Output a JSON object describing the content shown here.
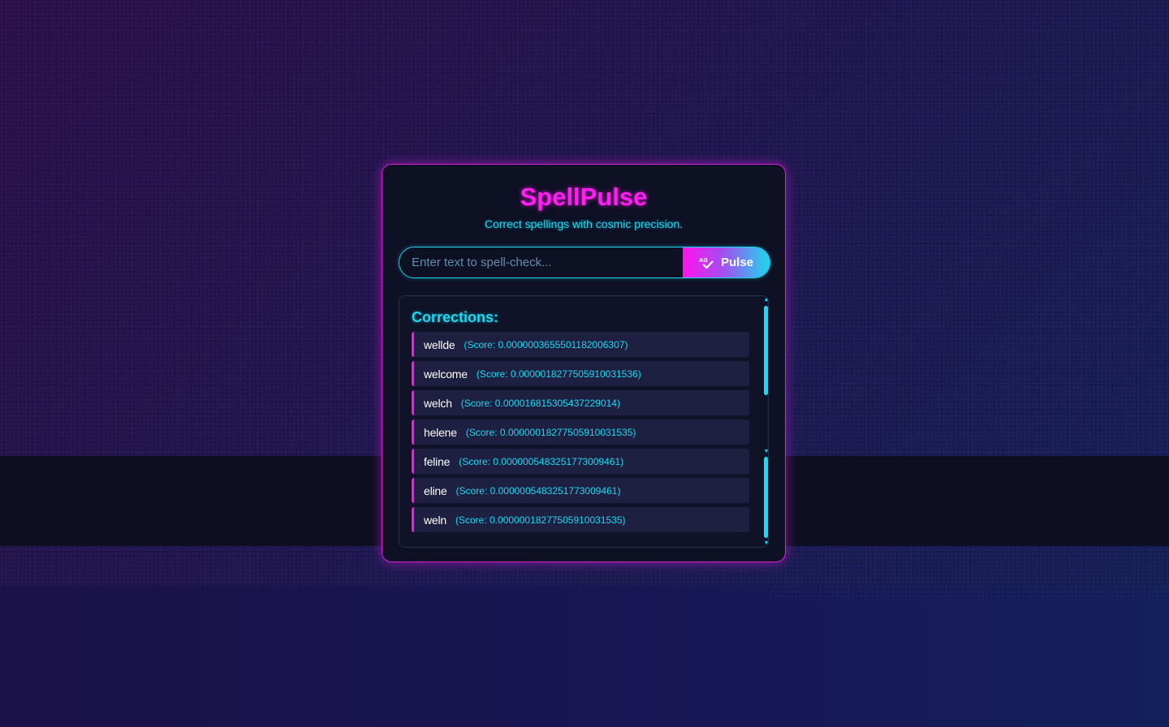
{
  "app": {
    "title": "SpellPulse",
    "subtitle": "Correct spellings with cosmic precision."
  },
  "search": {
    "placeholder": "Enter text to spell-check...",
    "value": "",
    "button_label": "Pulse",
    "button_icon": "spell-check-icon"
  },
  "results": {
    "heading": "Corrections:",
    "items": [
      {
        "word": "wellde",
        "score": "(Score: 0.0000003655501182006307)"
      },
      {
        "word": "welcome",
        "score": "(Score: 0.0000018277505910031536)"
      },
      {
        "word": "welch",
        "score": "(Score: 0.000016815305437229014)"
      },
      {
        "word": "helene",
        "score": "(Score: 0.00000018277505910031535)"
      },
      {
        "word": "feline",
        "score": "(Score: 0.0000005483251773009461)"
      },
      {
        "word": "eline",
        "score": "(Score: 0.0000005483251773009461)"
      },
      {
        "word": "weln",
        "score": "(Score: 0.00000018277505910031535)"
      }
    ]
  },
  "colors": {
    "accent_magenta": "#ff13ee",
    "accent_cyan": "#1ed8f0",
    "card_background": "#0e1024"
  }
}
